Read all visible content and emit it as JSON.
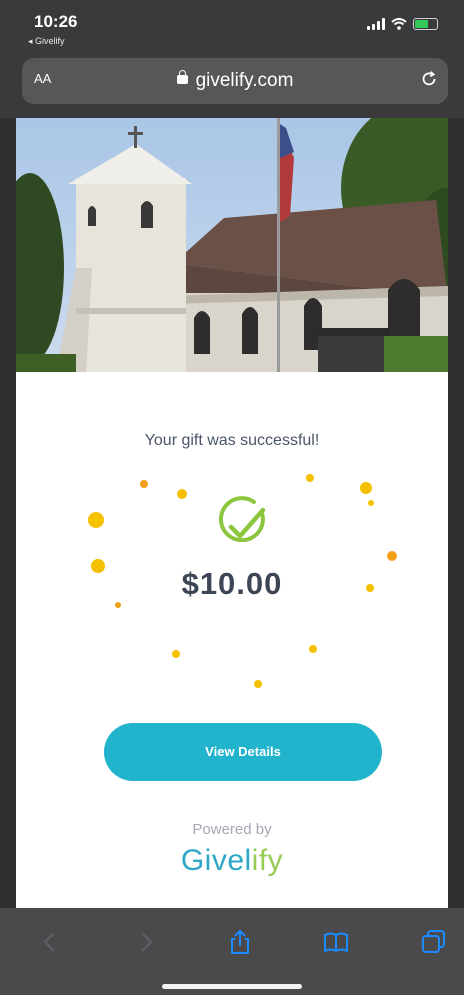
{
  "status_bar": {
    "time": "10:26",
    "back_app": "◂ Givelify"
  },
  "browser": {
    "text_size_label": "AA",
    "url": "givelify.com"
  },
  "page": {
    "success_message": "Your gift was successful!",
    "amount": "$10.00",
    "view_details_label": "View Details",
    "powered_by": "Powered by",
    "brand_part1": "Givel",
    "brand_part2": "ify"
  },
  "colors": {
    "accent": "#22b4cc",
    "check": "#8cc63e",
    "confetti": "#f5c000",
    "brand_blue": "#2da7c4",
    "brand_green": "#96cb54"
  }
}
